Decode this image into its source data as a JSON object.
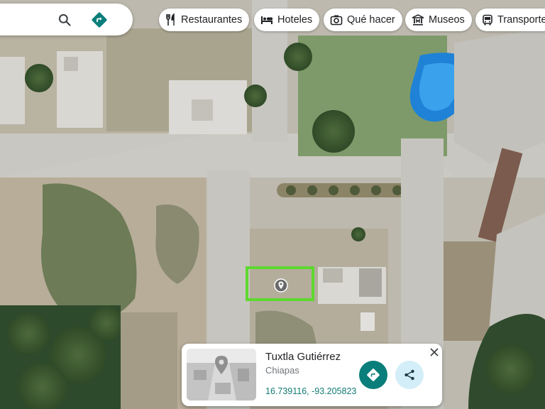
{
  "search": {
    "search_icon": "search-icon",
    "directions_icon": "directions-icon"
  },
  "categories": [
    {
      "label": "Restaurantes",
      "icon": "fork-knife-icon"
    },
    {
      "label": "Hoteles",
      "icon": "bed-icon"
    },
    {
      "label": "Qué hacer",
      "icon": "camera-icon"
    },
    {
      "label": "Museos",
      "icon": "museum-icon"
    },
    {
      "label": "Transporte",
      "icon": "bus-icon"
    }
  ],
  "marker": {
    "icon": "location-pin-icon",
    "highlight_color": "#5ed82f"
  },
  "info_card": {
    "title": "Tuxtla Gutiérrez",
    "subtitle": "Chiapas",
    "coordinates": "16.739116, -93.205823",
    "directions_icon": "directions-icon",
    "share_icon": "share-icon",
    "close_icon": "close-icon"
  },
  "colors": {
    "accent_teal": "#0a7e7a",
    "coordinates_text": "#137b73",
    "share_bg": "#d3eef8"
  }
}
